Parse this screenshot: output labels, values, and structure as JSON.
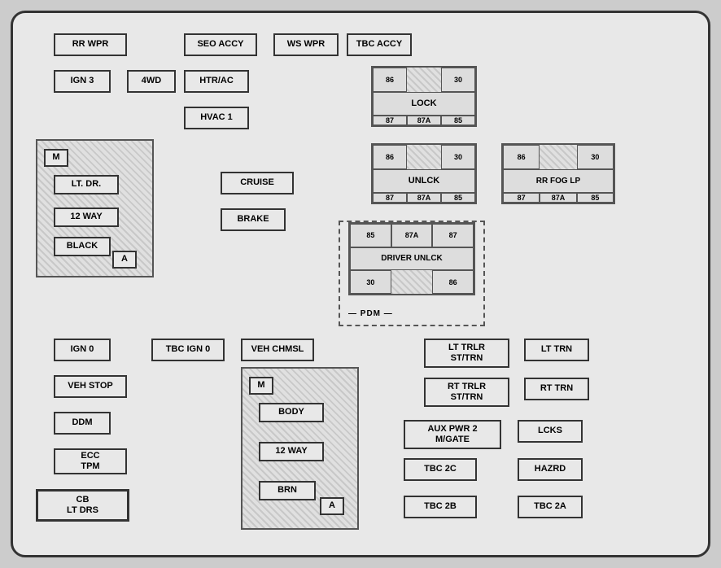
{
  "boxes": {
    "rr_wpr": "RR WPR",
    "seo_accy": "SEO ACCY",
    "ws_wpr": "WS WPR",
    "tbc_accy": "TBC ACCY",
    "ign3": "IGN 3",
    "fwd": "4WD",
    "htr_ac": "HTR/AC",
    "hvac1": "HVAC 1",
    "cruise": "CRUISE",
    "brake": "BRAKE",
    "ign0": "IGN 0",
    "tbc_ign0": "TBC IGN 0",
    "veh_chmsl": "VEH CHMSL",
    "veh_stop": "VEH STOP",
    "ddm": "DDM",
    "ecc_tpm": "ECC\nTPM",
    "cb_lt_drs": "CB\nLT DRS",
    "lt_trlr": "LT TRLR\nST/TRN",
    "lt_trn": "LT TRN",
    "rt_trlr": "RT TRLR\nST/TRN",
    "rt_trn": "RT TRN",
    "aux_pwr2": "AUX PWR 2\nM/GATE",
    "lcks": "LCKS",
    "tbc_2c": "TBC 2C",
    "hazrd": "HAZRD",
    "tbc_2b": "TBC 2B",
    "tbc_2a": "TBC 2A",
    "pdm": "PDM",
    "m_left": "M",
    "a_left": "A",
    "lt_dr": "LT. DR.",
    "way12_left": "12 WAY",
    "black": "BLACK",
    "m_right": "M",
    "a_right": "A",
    "body": "BODY",
    "way12_right": "12 WAY",
    "brn": "BRN"
  },
  "relay_lock": {
    "r86": "86",
    "r30": "30",
    "center": "LOCK",
    "r87": "87",
    "r87a": "87A",
    "r85": "85"
  },
  "relay_unlck": {
    "r86": "86",
    "r30": "30",
    "center": "UNLCK",
    "r87": "87",
    "r87a": "87A",
    "r85": "85"
  },
  "relay_rr_fog": {
    "r86": "86",
    "r30": "30",
    "center": "RR FOG LP",
    "r87": "87",
    "r87a": "87A",
    "r85": "85"
  },
  "relay_driver_unlck": {
    "r85": "85",
    "r87a": "87A",
    "r87": "87",
    "center": "DRIVER UNLCK",
    "r30": "30",
    "r86": "86"
  },
  "colors": {
    "background": "#e8e8e8",
    "border": "#333333",
    "shaded": "#c8c8c8"
  }
}
